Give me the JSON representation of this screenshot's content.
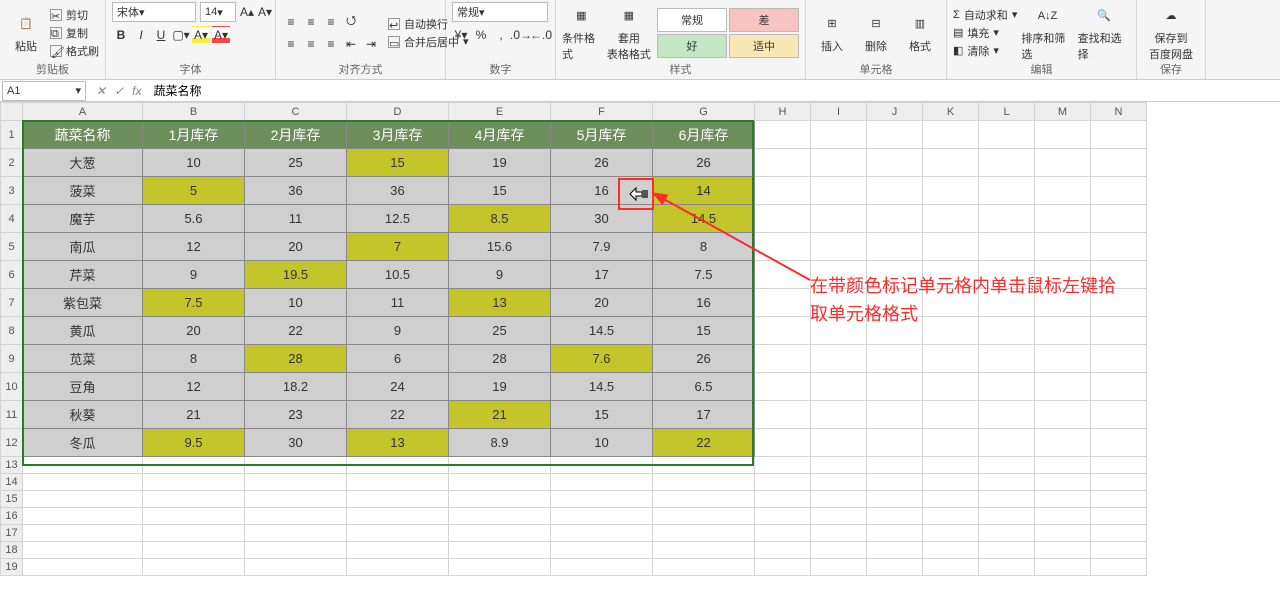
{
  "ribbon": {
    "groups": {
      "clipboard": {
        "label": "剪贴板",
        "paste": "粘贴",
        "cut": "剪切",
        "copy": "复制",
        "format_painter": "格式刷"
      },
      "font": {
        "label": "字体",
        "name": "宋体",
        "size": "14",
        "bold": "B",
        "italic": "I",
        "underline": "U"
      },
      "align": {
        "label": "对齐方式",
        "wrap": "自动换行",
        "merge": "合并后居中"
      },
      "number": {
        "label": "数字",
        "format": "常规"
      },
      "styles": {
        "label": "样式",
        "cond": "条件格式",
        "table": "套用\n表格格式",
        "normal": "常规",
        "bad": "差",
        "good": "好",
        "neutral": "适中"
      },
      "cells": {
        "label": "单元格",
        "insert": "插入",
        "delete": "删除",
        "format": "格式"
      },
      "editing": {
        "label": "编辑",
        "autosum": "自动求和",
        "fill": "填充",
        "clear": "清除",
        "sort": "排序和筛选",
        "find": "查找和选择"
      },
      "save": {
        "label": "保存",
        "save_cloud": "保存到\n百度网盘"
      }
    }
  },
  "formula_bar": {
    "namebox": "A1",
    "fx": "fx",
    "value": "蔬菜名称"
  },
  "columns": [
    "A",
    "B",
    "C",
    "D",
    "E",
    "F",
    "G",
    "H",
    "I",
    "J",
    "K",
    "L",
    "M",
    "N"
  ],
  "rows_visible": 19,
  "data_cols_used": 7,
  "data_rows": 12,
  "headers": [
    "蔬菜名称",
    "1月库存",
    "2月库存",
    "3月库存",
    "4月库存",
    "5月库存",
    "6月库存"
  ],
  "table": [
    [
      "大葱",
      "10",
      "25",
      "15",
      "19",
      "26",
      "26"
    ],
    [
      "菠菜",
      "5",
      "36",
      "36",
      "15",
      "16",
      "14"
    ],
    [
      "魔芋",
      "5.6",
      "11",
      "12.5",
      "8.5",
      "30",
      "14.5"
    ],
    [
      "南瓜",
      "12",
      "20",
      "7",
      "15.6",
      "7.9",
      "8"
    ],
    [
      "芹菜",
      "9",
      "19.5",
      "10.5",
      "9",
      "17",
      "7.5"
    ],
    [
      "紫包菜",
      "7.5",
      "10",
      "11",
      "13",
      "20",
      "16"
    ],
    [
      "黄瓜",
      "20",
      "22",
      "9",
      "25",
      "14.5",
      "15"
    ],
    [
      "苋菜",
      "8",
      "28",
      "6",
      "28",
      "7.6",
      "26"
    ],
    [
      "豆角",
      "12",
      "18.2",
      "24",
      "19",
      "14.5",
      "6.5"
    ],
    [
      "秋葵",
      "21",
      "23",
      "22",
      "21",
      "15",
      "17"
    ],
    [
      "冬瓜",
      "9.5",
      "30",
      "13",
      "8.9",
      "10",
      "22"
    ]
  ],
  "highlight": {
    "0": [
      3
    ],
    "1": [
      1,
      6
    ],
    "2": [
      4,
      6
    ],
    "3": [
      3
    ],
    "4": [
      2
    ],
    "5": [
      1,
      4
    ],
    "6": [],
    "7": [
      2,
      5
    ],
    "8": [],
    "9": [
      4
    ],
    "10": [
      1,
      3,
      6
    ]
  },
  "annotation": {
    "text_line1": "在带颜色标记单元格内单击鼠标左键拾",
    "text_line2": "取单元格格式"
  },
  "chart_data": {
    "type": "table",
    "title": "蔬菜各月库存",
    "columns": [
      "蔬菜名称",
      "1月库存",
      "2月库存",
      "3月库存",
      "4月库存",
      "5月库存",
      "6月库存"
    ],
    "rows": [
      [
        "大葱",
        10,
        25,
        15,
        19,
        26,
        26
      ],
      [
        "菠菜",
        5,
        36,
        36,
        15,
        16,
        14
      ],
      [
        "魔芋",
        5.6,
        11,
        12.5,
        8.5,
        30,
        14.5
      ],
      [
        "南瓜",
        12,
        20,
        7,
        15.6,
        7.9,
        8
      ],
      [
        "芹菜",
        9,
        19.5,
        10.5,
        9,
        17,
        7.5
      ],
      [
        "紫包菜",
        7.5,
        10,
        11,
        13,
        20,
        16
      ],
      [
        "黄瓜",
        20,
        22,
        9,
        25,
        14.5,
        15
      ],
      [
        "苋菜",
        8,
        28,
        6,
        28,
        7.6,
        26
      ],
      [
        "豆角",
        12,
        18.2,
        24,
        19,
        14.5,
        6.5
      ],
      [
        "秋葵",
        21,
        23,
        22,
        21,
        15,
        17
      ],
      [
        "冬瓜",
        9.5,
        30,
        13,
        8.9,
        10,
        22
      ]
    ]
  }
}
